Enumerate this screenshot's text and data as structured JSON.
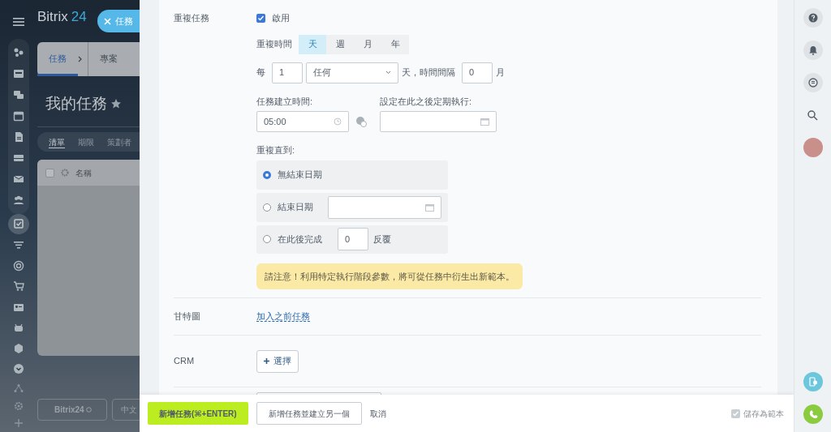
{
  "background_page": {
    "logo": {
      "text": "Bitrix",
      "accent": "24"
    },
    "close_pill": {
      "label": "任務"
    },
    "sidebar_items": [
      {
        "selected": false
      },
      {
        "selected": false
      },
      {
        "selected": false
      },
      {
        "selected": false
      },
      {
        "selected": false
      },
      {
        "selected": false
      },
      {
        "selected": false
      },
      {
        "selected": false
      },
      {
        "selected": true
      },
      {
        "selected": false
      },
      {
        "selected": false
      },
      {
        "selected": false
      },
      {
        "selected": false
      },
      {
        "selected": false
      },
      {
        "selected": false
      },
      {
        "selected": false
      }
    ],
    "breadcrumbs": [
      {
        "label": "任務",
        "selected": true
      },
      {
        "label": "專案",
        "selected": false
      }
    ],
    "page_title": "我的任務",
    "view_tabs": [
      {
        "label": "清單",
        "selected": true
      },
      {
        "label": "期限",
        "selected": false
      },
      {
        "label": "策劃者",
        "selected": false
      }
    ],
    "table": {
      "select_all": {
        "checked": false
      },
      "columns": [
        "名稱"
      ]
    },
    "footer_buttons": [
      "Bitrix24",
      "中文"
    ]
  },
  "form": {
    "repeat": {
      "label": "重複任務",
      "enabled": {
        "label": "啟用",
        "checked": true
      },
      "period_label": "重複時間",
      "periods": [
        {
          "label": "天",
          "selected": true
        },
        {
          "label": "週",
          "selected": false
        },
        {
          "label": "月",
          "selected": false
        },
        {
          "label": "年",
          "selected": false
        }
      ],
      "every_prefix": "每",
      "every_value": "1",
      "day_type": "任何",
      "interval_text": "天，時間間隔",
      "interval_value": "0",
      "interval_unit": "月",
      "create_time_label": "任務建立時間:",
      "create_time": "05:00",
      "start_after_label": "設定在此之後定期執行:",
      "repeat_until_label": "重複直到:",
      "until_options": [
        {
          "kind": "none",
          "label": "無結束日期",
          "selected": true
        },
        {
          "kind": "date",
          "label": "結束日期",
          "selected": false
        },
        {
          "kind": "count",
          "label": "在此後完成",
          "selected": false,
          "value": "0",
          "suffix": "反覆"
        }
      ],
      "notice": "請注意！利用特定執行階段參數，將可從任務中衍生出新範本。"
    },
    "gantt": {
      "label": "甘特圖",
      "link": "加入之前任務"
    },
    "crm": {
      "label": "CRM",
      "button": "選擇"
    }
  },
  "footer": {
    "primary": "新增任務(⌘+ENTER)",
    "secondary": "新增任務並建立另一個",
    "cancel": "取消",
    "save_template": {
      "label": "儲存為範本",
      "checked": true
    }
  }
}
